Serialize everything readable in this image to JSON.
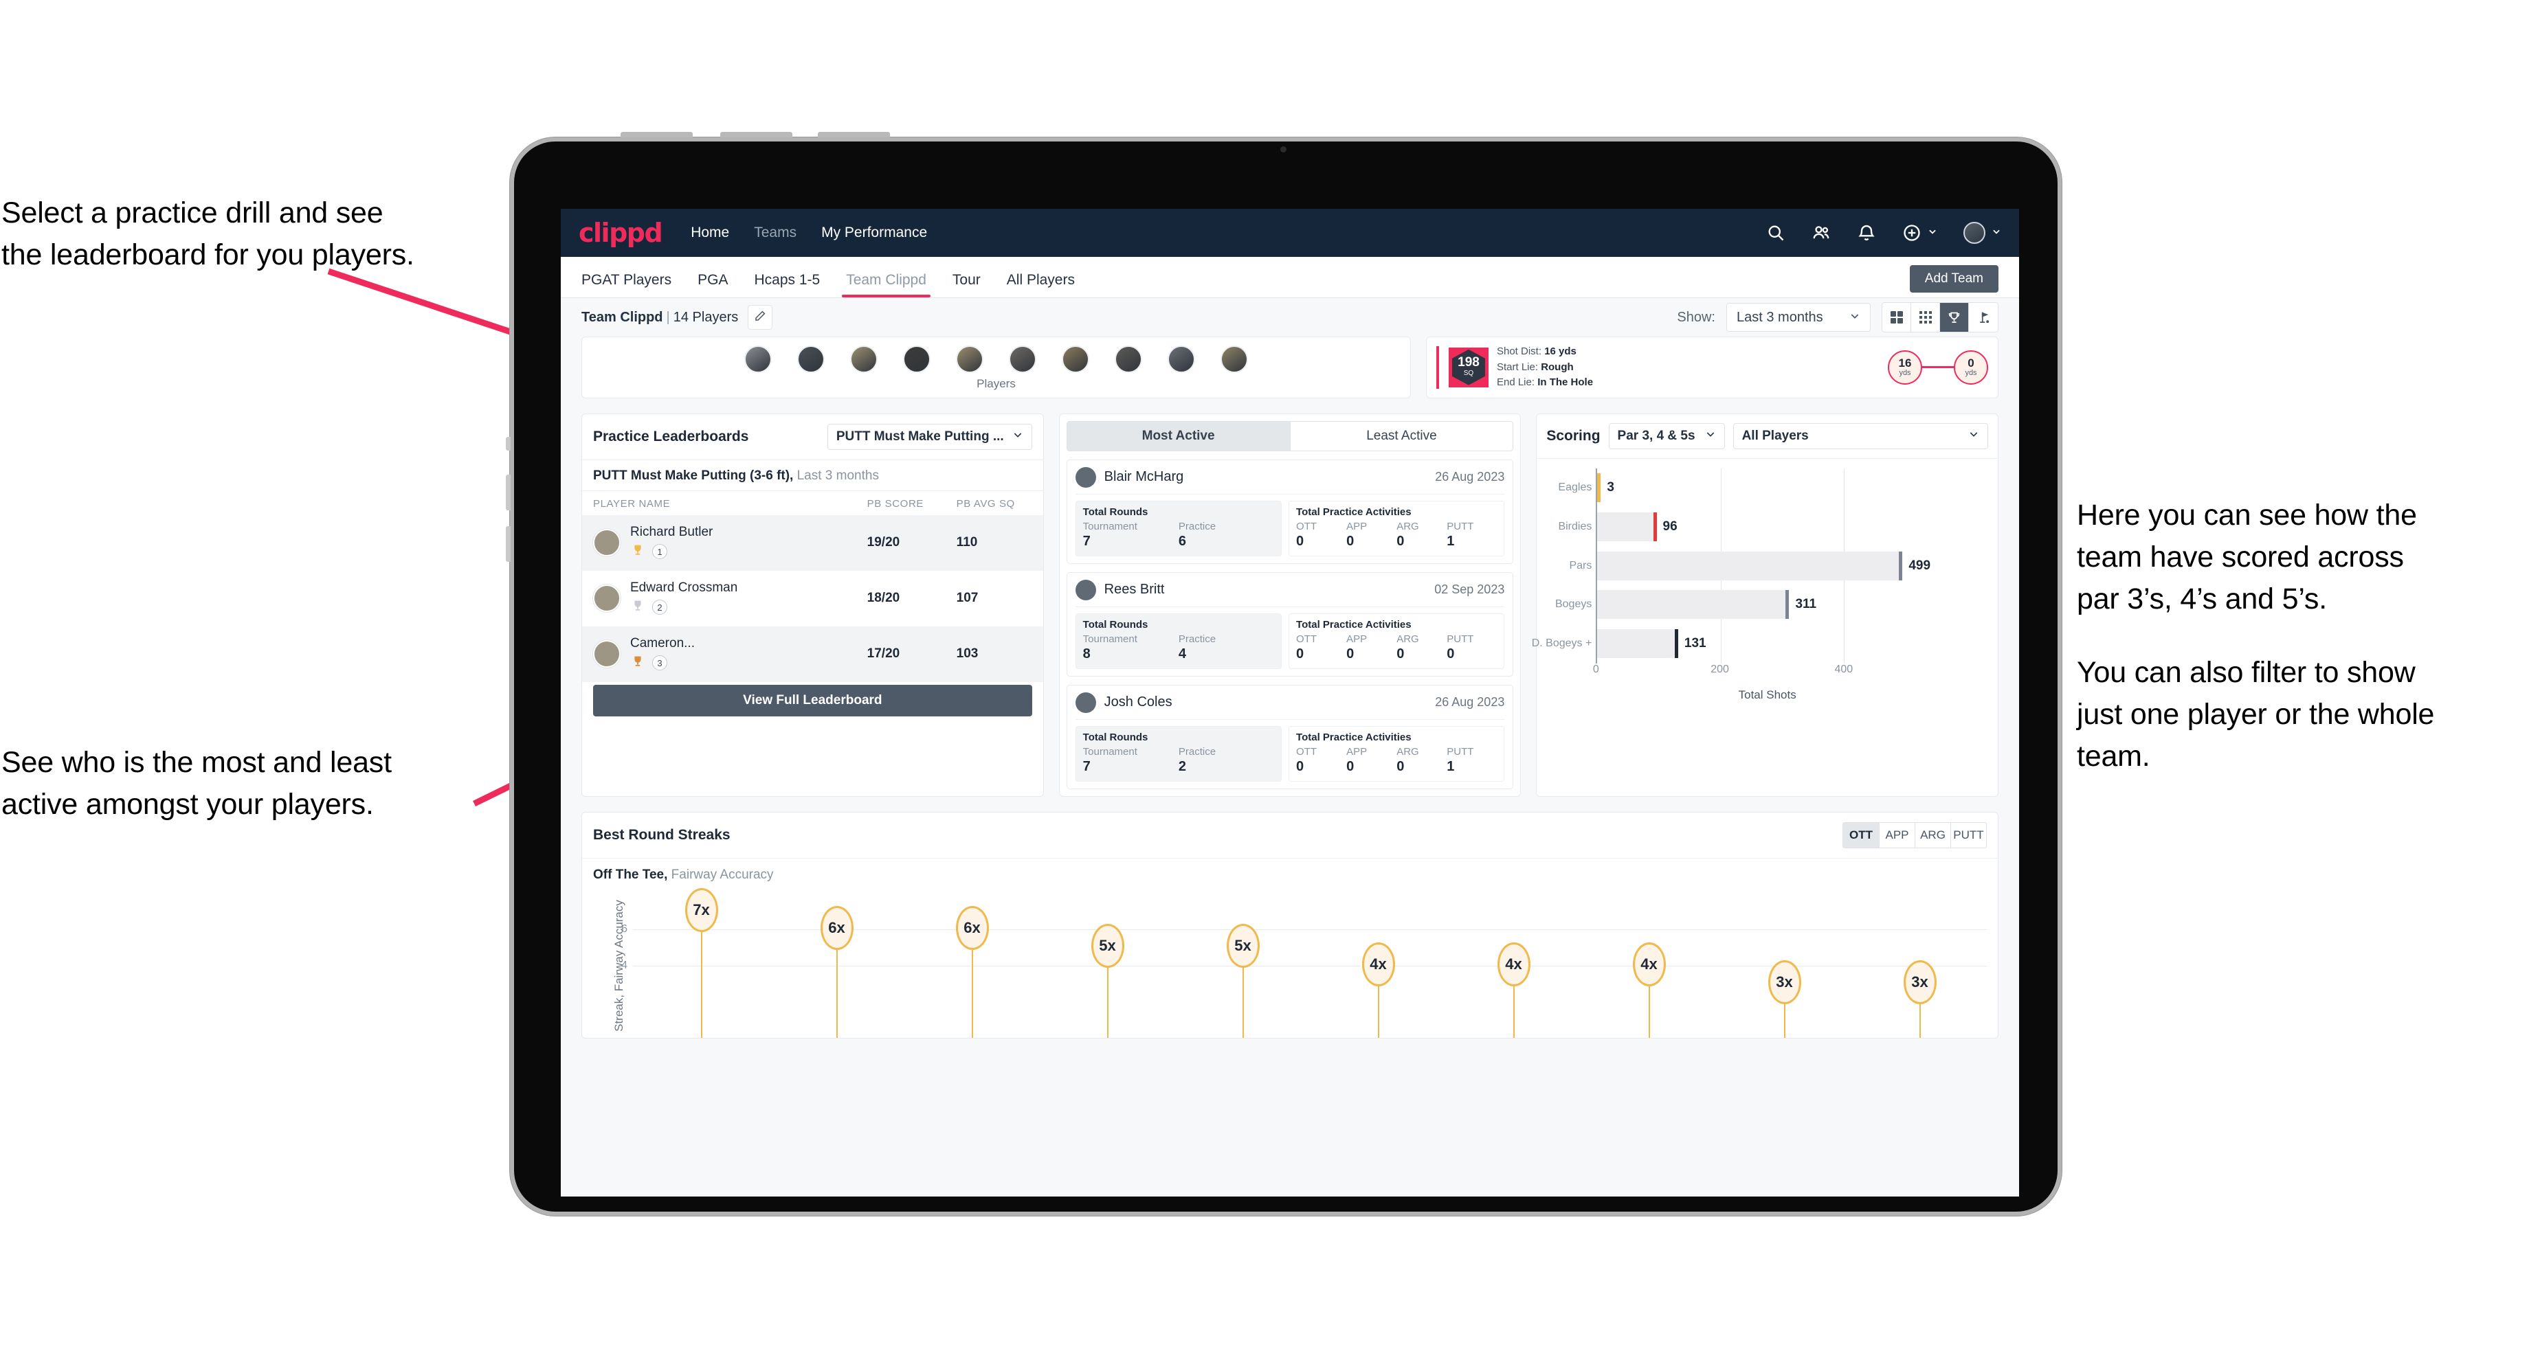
{
  "annotations": {
    "top_left": [
      "Select a practice drill and see",
      "the leaderboard for you players."
    ],
    "bottom_left": [
      "See who is the most and least",
      "active amongst your players."
    ],
    "right_p1": [
      "Here you can see how the",
      "team have scored across",
      "par 3’s, 4’s and 5’s."
    ],
    "right_p2": [
      "You can also filter to show",
      "just one player or the whole",
      "team."
    ]
  },
  "navbar": {
    "logo": "clippd",
    "links": [
      {
        "label": "Home",
        "active": true
      },
      {
        "label": "Teams",
        "active": false
      },
      {
        "label": "My Performance",
        "active": true
      }
    ],
    "icons": [
      "search-icon",
      "people-icon",
      "bell-icon",
      "plus-circle-icon",
      "avatar"
    ]
  },
  "tabs": [
    {
      "label": "PGAT Players",
      "active": false
    },
    {
      "label": "PGA",
      "active": false
    },
    {
      "label": "Hcaps 1-5",
      "active": false
    },
    {
      "label": "Team Clippd",
      "active": true
    },
    {
      "label": "Tour",
      "active": false
    },
    {
      "label": "All Players",
      "active": false
    }
  ],
  "add_team_label": "Add Team",
  "subbar": {
    "team_name": "Team Clippd",
    "separator": "|",
    "player_count": "14 Players",
    "edit_icon": "pencil-icon",
    "show_label": "Show:",
    "range_value": "Last 3 months",
    "view_modes": [
      "grid-large-icon",
      "grid-small-icon",
      "trophy-icon",
      "flag-icon"
    ],
    "active_view": "trophy-icon"
  },
  "players_strip": {
    "label": "Players",
    "count": 10
  },
  "shot_card": {
    "sq_value": "198",
    "sq_unit": "SQ",
    "lines": [
      {
        "label": "Shot Dist:",
        "value": "16 yds"
      },
      {
        "label": "Start Lie:",
        "value": "Rough"
      },
      {
        "label": "End Lie:",
        "value": "In The Hole"
      }
    ],
    "start_dist": "16",
    "start_unit": "yds",
    "end_dist": "0",
    "end_unit": "yds"
  },
  "leaderboard": {
    "title": "Practice Leaderboards",
    "drill_select": "PUTT Must Make Putting ...",
    "subtitle_bold": "PUTT Must Make Putting (3-6 ft),",
    "subtitle_rest": "Last 3 months",
    "columns": [
      "PLAYER NAME",
      "PB SCORE",
      "PB AVG SQ"
    ],
    "rows": [
      {
        "name": "Richard Butler",
        "rank": "1",
        "trophy": "gold",
        "score": "19/20",
        "avg": "110"
      },
      {
        "name": "Edward Crossman",
        "rank": "2",
        "trophy": "silver",
        "score": "18/20",
        "avg": "107"
      },
      {
        "name": "Cameron...",
        "rank": "3",
        "trophy": "bronze",
        "score": "17/20",
        "avg": "103"
      }
    ],
    "view_full_label": "View Full Leaderboard"
  },
  "activity": {
    "toggle": [
      {
        "label": "Most Active",
        "active": true
      },
      {
        "label": "Least Active",
        "active": false
      }
    ],
    "rounds_title": "Total Rounds",
    "rounds_keys": [
      "Tournament",
      "Practice"
    ],
    "practice_title": "Total Practice Activities",
    "practice_keys": [
      "OTT",
      "APP",
      "ARG",
      "PUTT"
    ],
    "players": [
      {
        "name": "Blair McHarg",
        "date": "26 Aug 2023",
        "tournament": "7",
        "practice": "6",
        "ott": "0",
        "app": "0",
        "arg": "0",
        "putt": "1"
      },
      {
        "name": "Rees Britt",
        "date": "02 Sep 2023",
        "tournament": "8",
        "practice": "4",
        "ott": "0",
        "app": "0",
        "arg": "0",
        "putt": "0"
      },
      {
        "name": "Josh Coles",
        "date": "26 Aug 2023",
        "tournament": "7",
        "practice": "2",
        "ott": "0",
        "app": "0",
        "arg": "0",
        "putt": "1"
      }
    ]
  },
  "scoring": {
    "title": "Scoring",
    "par_select": "Par 3, 4 & 5s",
    "player_select": "All Players"
  },
  "streaks": {
    "title": "Best Round Streaks",
    "segments": [
      {
        "label": "OTT",
        "active": true
      },
      {
        "label": "APP",
        "active": false
      },
      {
        "label": "ARG",
        "active": false
      },
      {
        "label": "PUTT",
        "active": false
      }
    ],
    "sub_bold": "Off The Tee,",
    "sub_rest": "Fairway Accuracy"
  },
  "chart_data": [
    {
      "type": "bar",
      "orientation": "horizontal",
      "title": "Scoring",
      "categories": [
        "Eagles",
        "Birdies",
        "Pars",
        "Bogeys",
        "D. Bogeys +"
      ],
      "values": [
        3,
        96,
        499,
        311,
        131
      ],
      "cap_colors": [
        "#f0b94b",
        "#e03c3c",
        "#7b8490",
        "#7b8490",
        "#1e2836"
      ],
      "xlabel": "Total Shots",
      "ylabel": "",
      "xlim": [
        0,
        540
      ],
      "xticks": [
        0,
        200,
        400
      ],
      "grid": true,
      "legend": "none"
    },
    {
      "type": "scatter",
      "subtype": "lollipop",
      "title": "Best Round Streaks",
      "series_name": "Off The Tee, Fairway Accuracy",
      "ylabel": "Streak, Fairway Accuracy",
      "yticks": [
        4,
        6
      ],
      "ylim": [
        0,
        8
      ],
      "values": [
        7,
        6,
        6,
        5,
        5,
        4,
        4,
        4,
        3,
        3
      ],
      "labels": [
        "7x",
        "6x",
        "6x",
        "5x",
        "5x",
        "4x",
        "4x",
        "4x",
        "3x",
        "3x"
      ],
      "grid": true,
      "legend": "none"
    }
  ]
}
